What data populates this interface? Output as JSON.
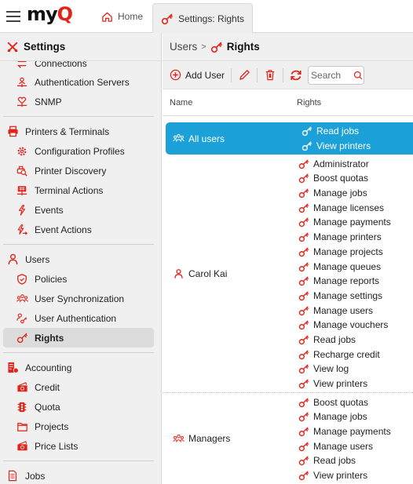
{
  "app": {
    "logo_text_main": "my",
    "logo_text_accent": "Q",
    "accent_color": "#e2231a",
    "selection_color": "#1ba1d8"
  },
  "tabs": [
    {
      "label": "Home",
      "icon": "home-icon",
      "active": false
    },
    {
      "label": "Settings: Rights",
      "icon": "key-icon",
      "active": true
    }
  ],
  "sidebar": {
    "title": "Settings",
    "title_icon": "tools-icon",
    "sections": [
      {
        "items": [
          {
            "label": "Connections",
            "icon": "connections-icon"
          },
          {
            "label": "Authentication Servers",
            "icon": "auth-server-icon"
          },
          {
            "label": "SNMP",
            "icon": "snmp-icon"
          }
        ]
      },
      {
        "group": "Printers & Terminals",
        "group_icon": "printer-icon",
        "items": [
          {
            "label": "Configuration Profiles",
            "icon": "gear-icon"
          },
          {
            "label": "Printer Discovery",
            "icon": "printer-discovery-icon"
          },
          {
            "label": "Terminal Actions",
            "icon": "terminal-icon"
          },
          {
            "label": "Events",
            "icon": "lightning-icon"
          },
          {
            "label": "Event Actions",
            "icon": "lightning-arrow-icon"
          }
        ]
      },
      {
        "group": "Users",
        "group_icon": "user-icon",
        "items": [
          {
            "label": "Policies",
            "icon": "shield-icon"
          },
          {
            "label": "User Synchronization",
            "icon": "users-sync-icon"
          },
          {
            "label": "User Authentication",
            "icon": "user-key-icon"
          },
          {
            "label": "Rights",
            "icon": "key-icon",
            "active": true
          }
        ]
      },
      {
        "group": "Accounting",
        "group_icon": "accounting-icon",
        "items": [
          {
            "label": "Credit",
            "icon": "money-icon"
          },
          {
            "label": "Quota",
            "icon": "quota-icon"
          },
          {
            "label": "Projects",
            "icon": "folder-icon"
          },
          {
            "label": "Price Lists",
            "icon": "money-icon"
          }
        ]
      },
      {
        "group": "Jobs",
        "group_icon": "document-icon",
        "items": []
      }
    ]
  },
  "breadcrumb": {
    "parent": "Users",
    "separator": ">",
    "current": "Rights"
  },
  "toolbar": {
    "add_label": "Add User",
    "search_placeholder": "Search"
  },
  "table": {
    "columns": [
      "Name",
      "Rights"
    ],
    "rows": [
      {
        "name": "All users",
        "icon": "users-group-icon",
        "selected": true,
        "rights": [
          "Read jobs",
          "View printers"
        ]
      },
      {
        "name": "Carol Kai",
        "icon": "user-icon",
        "selected": false,
        "rights": [
          "Administrator",
          "Boost quotas",
          "Manage jobs",
          "Manage licenses",
          "Manage payments",
          "Manage printers",
          "Manage projects",
          "Manage queues",
          "Manage reports",
          "Manage settings",
          "Manage users",
          "Manage vouchers",
          "Read jobs",
          "Recharge credit",
          "View log",
          "View printers"
        ]
      },
      {
        "name": "Managers",
        "icon": "users-group-icon",
        "selected": false,
        "rights": [
          "Boost quotas",
          "Manage jobs",
          "Manage payments",
          "Manage users",
          "Read jobs",
          "View printers"
        ]
      }
    ]
  }
}
